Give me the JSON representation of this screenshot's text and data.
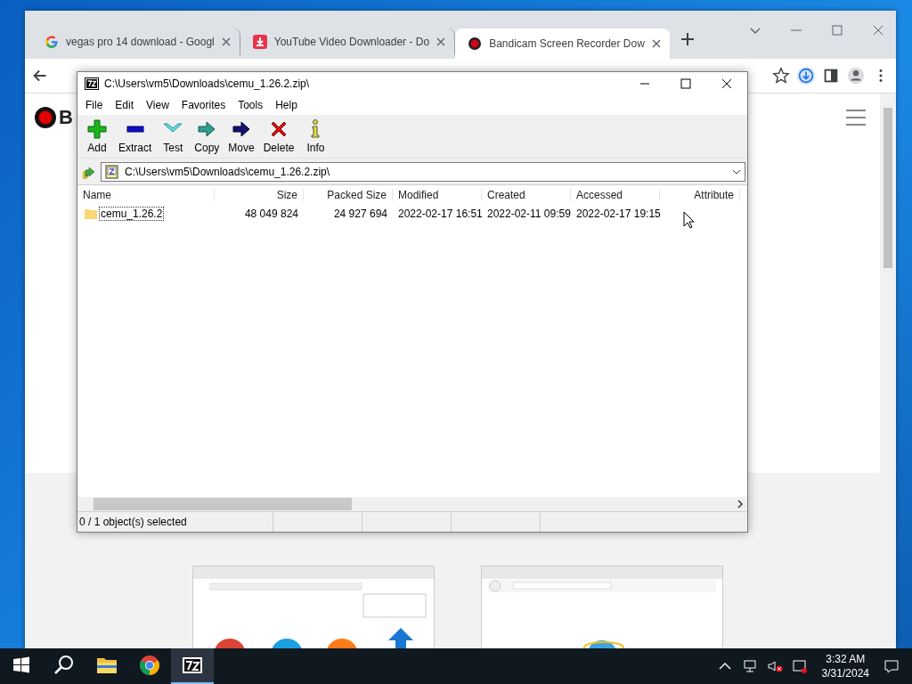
{
  "browser": {
    "tabs": [
      {
        "title": "vegas pro 14 download - Googl",
        "selected": false
      },
      {
        "title": "YouTube Video Downloader - Do",
        "selected": false
      },
      {
        "title": "Bandicam Screen Recorder Dow",
        "selected": true
      }
    ],
    "page": {
      "logo_text": "B"
    }
  },
  "archiver": {
    "title": "C:\\Users\\vm5\\Downloads\\cemu_1.26.2.zip\\",
    "menu": [
      "File",
      "Edit",
      "View",
      "Favorites",
      "Tools",
      "Help"
    ],
    "toolbar": [
      {
        "label": "Add",
        "kind": "add"
      },
      {
        "label": "Extract",
        "kind": "extract"
      },
      {
        "label": "Test",
        "kind": "test"
      },
      {
        "label": "Copy",
        "kind": "copy"
      },
      {
        "label": "Move",
        "kind": "move"
      },
      {
        "label": "Delete",
        "kind": "delete"
      },
      {
        "label": "Info",
        "kind": "info"
      }
    ],
    "address": "C:\\Users\\vm5\\Downloads\\cemu_1.26.2.zip\\",
    "columns": [
      "Name",
      "Size",
      "Packed Size",
      "Modified",
      "Created",
      "Accessed",
      "Attribute"
    ],
    "rows": [
      {
        "cells": [
          "cemu_1.26.2",
          "48 049 824",
          "24 927 694",
          "2022-02-17 16:51",
          "2022-02-11 09:59",
          "2022-02-17 19:15"
        ],
        "focused": true
      }
    ],
    "status": "0 / 1 object(s) selected"
  },
  "taskbar": {
    "apps": [
      {
        "kind": "search",
        "selected": false
      },
      {
        "kind": "folder",
        "selected": false
      },
      {
        "kind": "chrome",
        "selected": false
      },
      {
        "kind": "archiver",
        "selected": true
      }
    ],
    "time": "3:32 AM",
    "date": "3/31/2024"
  }
}
